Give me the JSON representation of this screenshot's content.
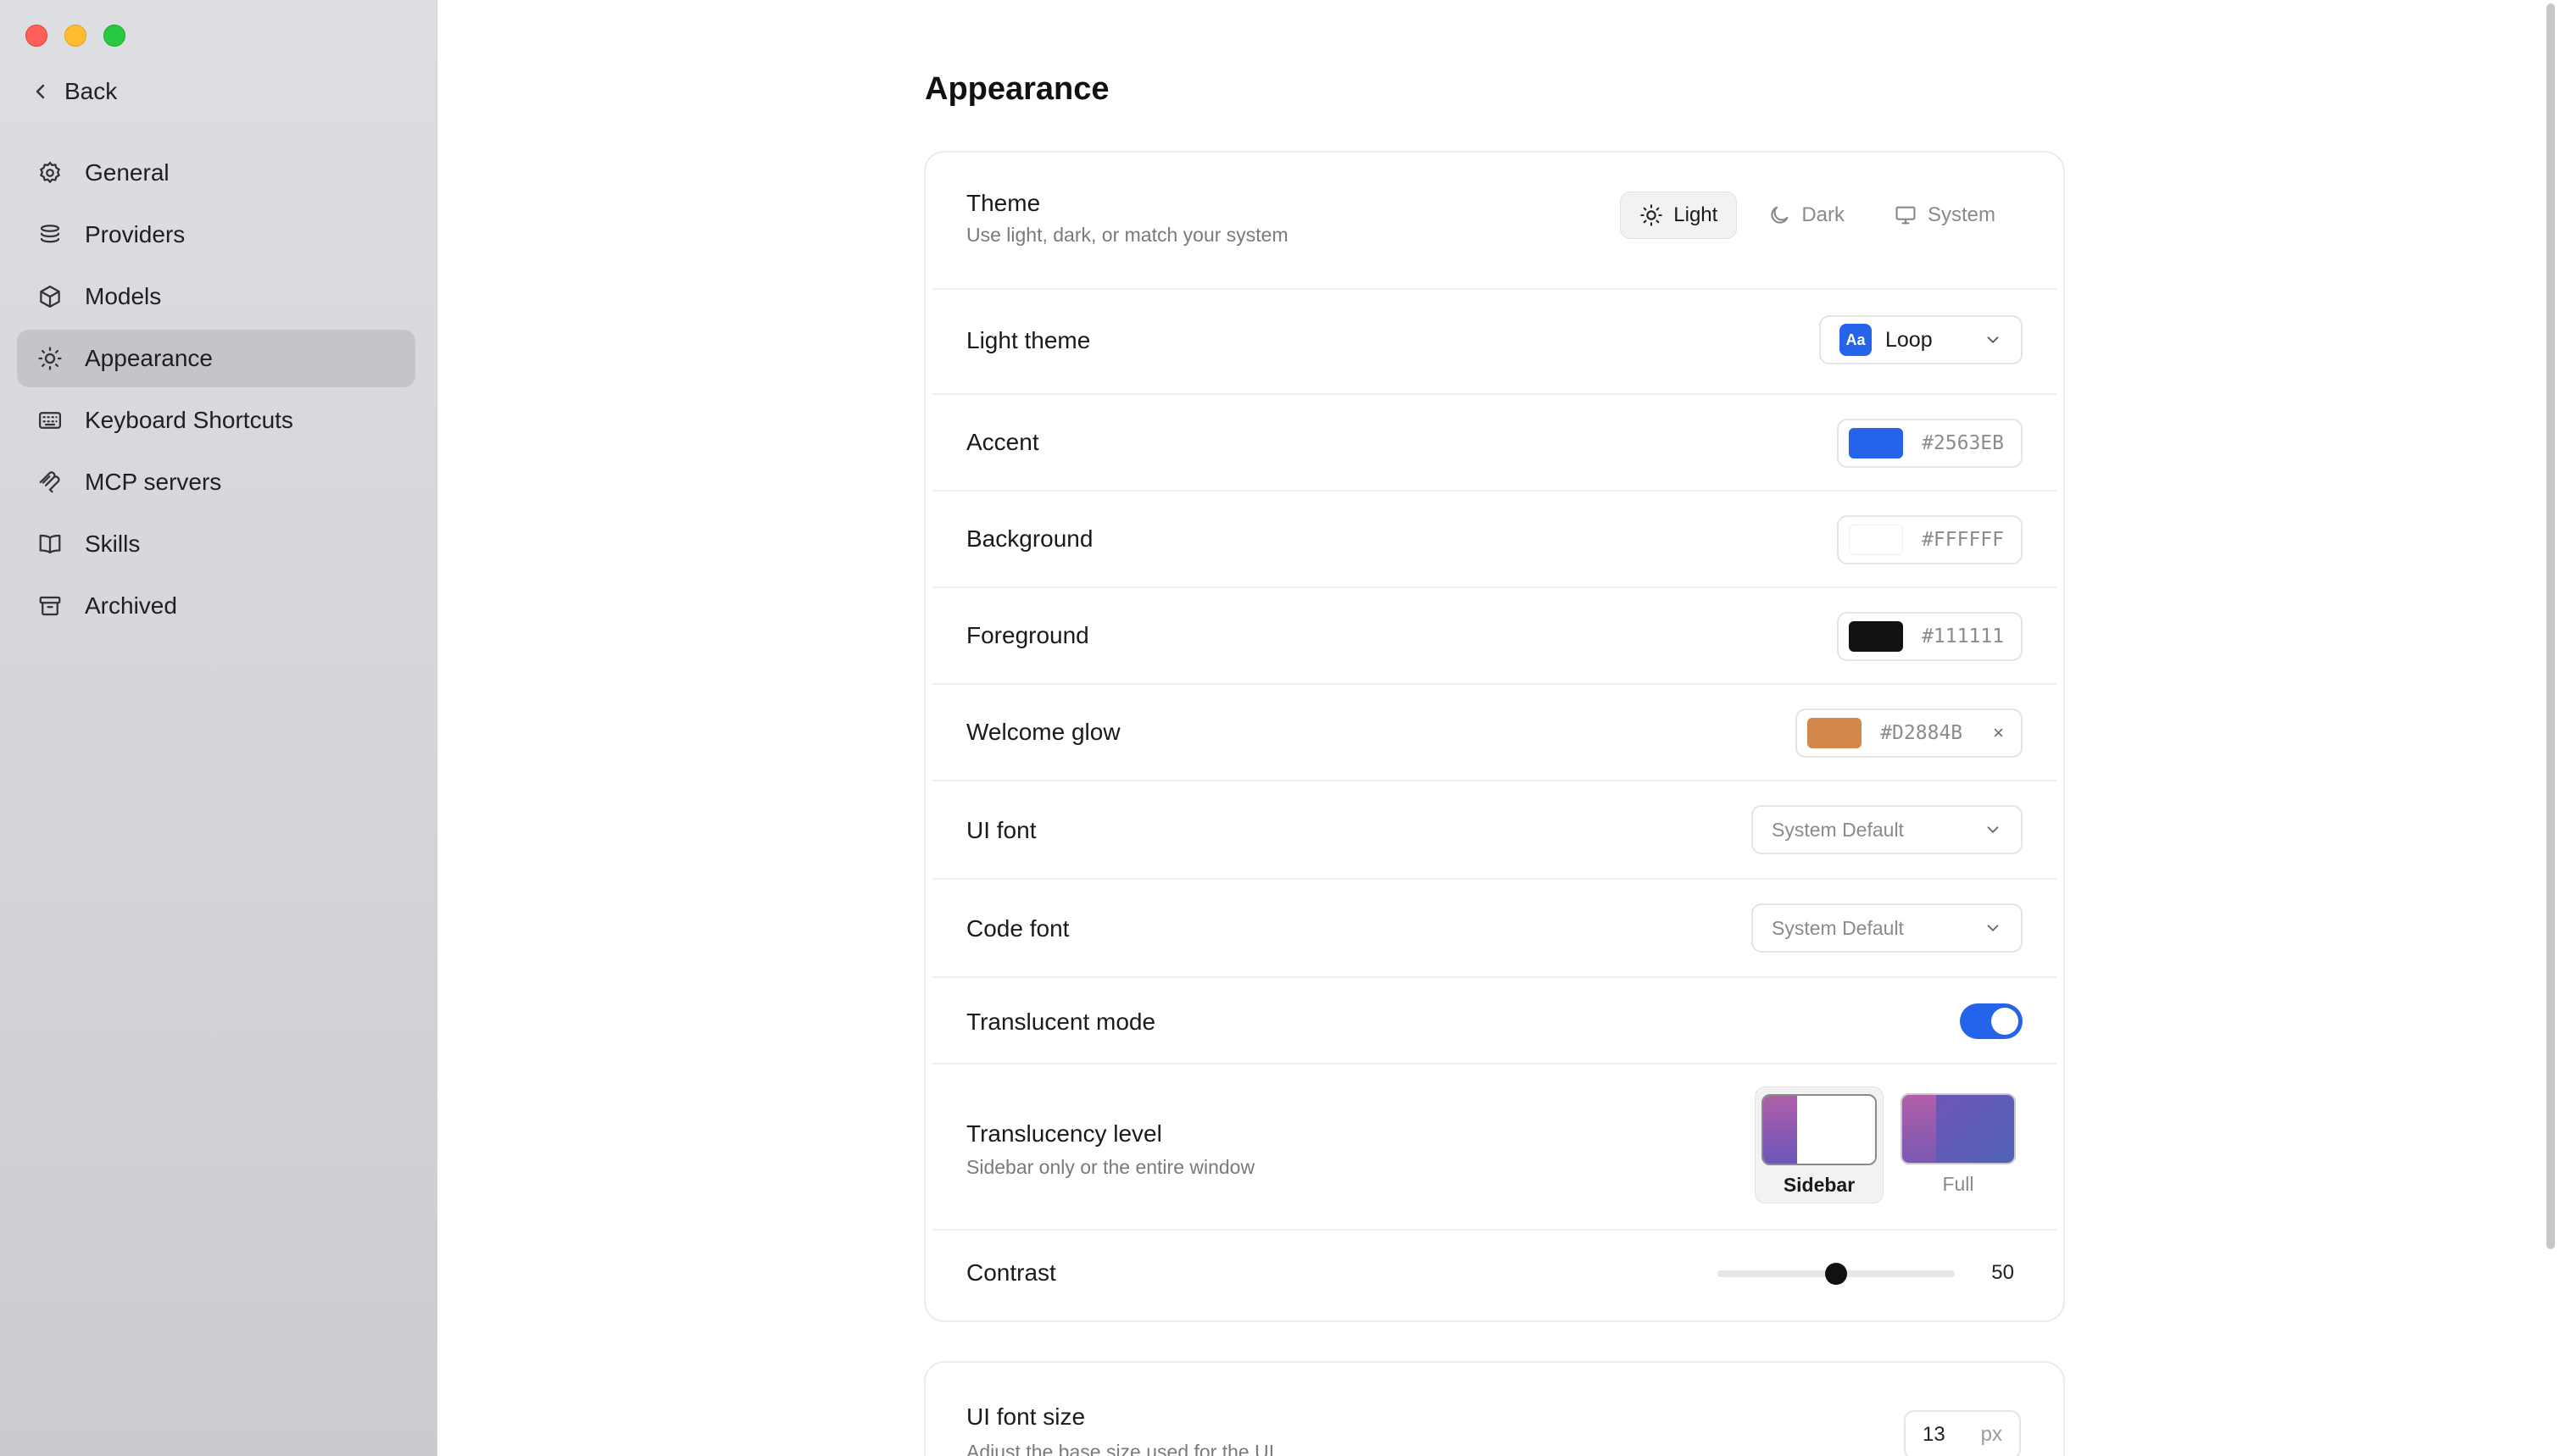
{
  "sidebar": {
    "back_label": "Back",
    "items": [
      {
        "label": "General",
        "icon": "gear-icon"
      },
      {
        "label": "Providers",
        "icon": "layers-icon"
      },
      {
        "label": "Models",
        "icon": "cube-icon"
      },
      {
        "label": "Appearance",
        "icon": "sun-icon",
        "active": true
      },
      {
        "label": "Keyboard Shortcuts",
        "icon": "keyboard-icon"
      },
      {
        "label": "MCP servers",
        "icon": "mcp-icon"
      },
      {
        "label": "Skills",
        "icon": "book-icon"
      },
      {
        "label": "Archived",
        "icon": "archive-icon"
      }
    ]
  },
  "main": {
    "title": "Appearance",
    "theme": {
      "label": "Theme",
      "description": "Use light, dark, or match your system",
      "options": [
        "Light",
        "Dark",
        "System"
      ],
      "selected": "Light"
    },
    "light_theme": {
      "label": "Light theme",
      "badge": "Aa",
      "value": "Loop"
    },
    "accent": {
      "label": "Accent",
      "value": "#2563EB",
      "color": "#2563EB"
    },
    "background": {
      "label": "Background",
      "value": "#FFFFFF",
      "color": "#FFFFFF"
    },
    "foreground": {
      "label": "Foreground",
      "value": "#111111",
      "color": "#111111"
    },
    "welcome_glow": {
      "label": "Welcome glow",
      "value": "#D2884B",
      "color": "#D2884B",
      "clear": "×"
    },
    "ui_font": {
      "label": "UI font",
      "value": "System Default"
    },
    "code_font": {
      "label": "Code font",
      "value": "System Default"
    },
    "translucent_mode": {
      "label": "Translucent mode",
      "enabled": true
    },
    "translucency_level": {
      "label": "Translucency level",
      "description": "Sidebar only or the entire window",
      "options": [
        "Sidebar",
        "Full"
      ],
      "selected": "Sidebar"
    },
    "contrast": {
      "label": "Contrast",
      "value": "50",
      "fraction": 0.5
    },
    "ui_font_size": {
      "label": "UI font size",
      "description": "Adjust the base size used for the UI",
      "value": "13",
      "unit": "px"
    }
  }
}
